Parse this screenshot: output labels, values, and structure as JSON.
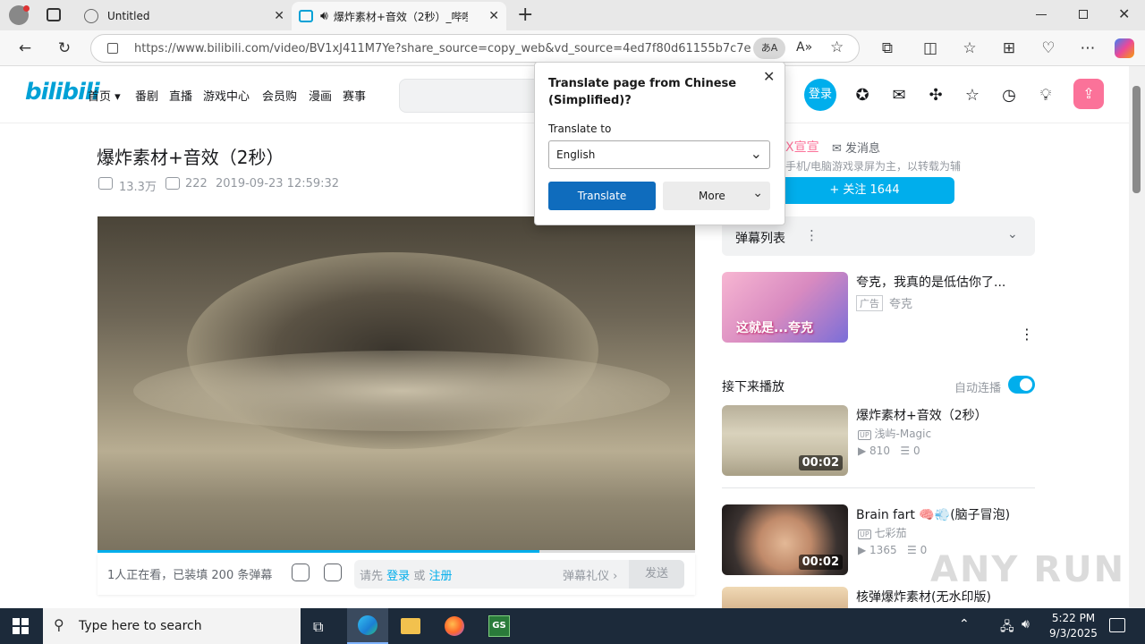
{
  "browser": {
    "tab1_title": "Untitled",
    "tab2_title": "爆炸素材+音效（2秒）_哔哩",
    "url": "https://www.bilibili.com/video/BV1xJ411M7Ye?share_source=copy_web&vd_source=4ed7f80d61155b7c7eee..."
  },
  "nav": {
    "logo": "bilibili",
    "items": [
      "首页",
      "番剧",
      "直播",
      "游戏中心",
      "会员购",
      "漫画",
      "赛事"
    ],
    "login": "登录"
  },
  "translate": {
    "title": "Translate page from Chinese (Simplified)?",
    "label": "Translate to",
    "language": "English",
    "translate_btn": "Translate",
    "more_btn": "More"
  },
  "video": {
    "title": "爆炸素材+音效（2秒）",
    "views": "13.3万",
    "danmaku": "222",
    "date": "2019-09-23 12:59:32",
    "progress": 0.74,
    "watching": "1人正在看，已装填 200 条弹幕",
    "input_prefix": "请先",
    "login": "登录",
    "or": "或",
    "register": "注册",
    "etiquette": "弹幕礼仪 ›",
    "send": "发送"
  },
  "uploader": {
    "name": "X宣宣",
    "message": "发消息",
    "desc": "手机/电脑游戏录屏为主，以转载为辅",
    "follow": "+ 关注 1644"
  },
  "danmaku_list": {
    "label": "弹幕列表"
  },
  "ad": {
    "title": "夸克，我真的是低估你了...",
    "tag": "广告",
    "brand": "夸克",
    "thumb_text": "这就是...夸克"
  },
  "next": {
    "label": "接下来播放",
    "autoplay": "自动连播",
    "items": [
      {
        "title": "爆炸素材+音效（2秒）",
        "author": "浅屿-Magic",
        "views": "810",
        "danmaku": "0",
        "duration": "00:02"
      },
      {
        "title": "Brain fart 🧠💨(脑子冒泡)",
        "author": "七彩茄",
        "views": "1365",
        "danmaku": "0",
        "duration": "00:02"
      },
      {
        "title": "核弹爆炸素材(无水印版)"
      }
    ]
  },
  "taskbar": {
    "search_placeholder": "Type here to search",
    "time": "5:22 PM",
    "date": "9/3/2025"
  },
  "watermark": "ANY RUN"
}
